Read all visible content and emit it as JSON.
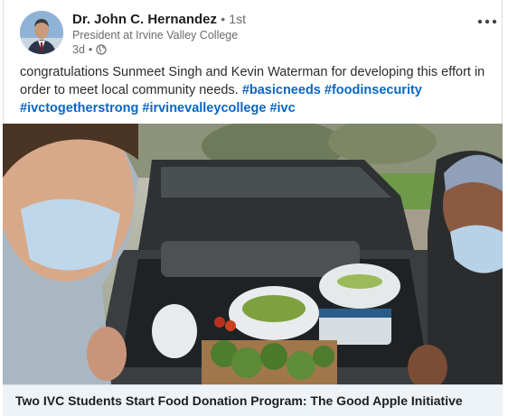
{
  "post": {
    "author_name": "Dr. John C. Hernandez",
    "separator": "•",
    "degree": "1st",
    "headline": "President at Irvine Valley College",
    "time": "3d",
    "visibility_icon": "globe-icon",
    "more_menu_icon": "more-horizontal-icon",
    "text_intro": "congratulations Sunmeet Singh and Kevin Waterman for developing this effort in order to meet local community needs.",
    "hashtags": [
      "#basicneeds",
      "#foodinsecurity",
      "#ivctogetherstrong",
      "#irvinevalleycollege",
      "#ivc"
    ]
  },
  "link_preview": {
    "title": "Two IVC Students Start Food Donation Program: The Good Apple Initiative"
  },
  "colors": {
    "hashtag": "#0a66c2",
    "preview_bar": "#eef3f8"
  }
}
